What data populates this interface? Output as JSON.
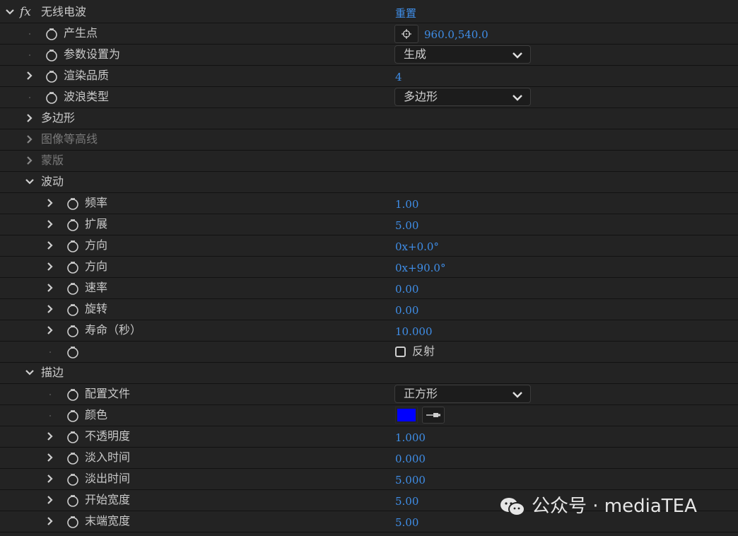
{
  "effect": {
    "name": "无线电波",
    "reset_label": "重置"
  },
  "rows": {
    "origin": {
      "label": "产生点",
      "value": "960.0,540.0"
    },
    "param_set": {
      "label": "参数设置为",
      "value": "生成"
    },
    "render_quality": {
      "label": "渲染品质",
      "value": "4"
    },
    "wave_type": {
      "label": "波浪类型",
      "value": "多边形"
    },
    "polygon": {
      "label": "多边形"
    },
    "image_contour": {
      "label": "图像等高线"
    },
    "mask": {
      "label": "蒙版"
    },
    "wave_motion": {
      "label": "波动"
    },
    "frequency": {
      "label": "频率",
      "value": "1.00"
    },
    "expansion": {
      "label": "扩展",
      "value": "5.00"
    },
    "orientation": {
      "label": "方向",
      "value": "0x+0.0°"
    },
    "direction": {
      "label": "方向",
      "value": "0x+90.0°"
    },
    "velocity": {
      "label": "速率",
      "value": "0.00"
    },
    "spin": {
      "label": "旋转",
      "value": "0.00"
    },
    "lifespan": {
      "label": "寿命（秒）",
      "value": "10.000"
    },
    "reflection": {
      "label": "反射"
    },
    "stroke": {
      "label": "描边"
    },
    "profile": {
      "label": "配置文件",
      "value": "正方形"
    },
    "color": {
      "label": "颜色",
      "swatch": "#0000ff"
    },
    "opacity": {
      "label": "不透明度",
      "value": "1.000"
    },
    "fade_in": {
      "label": "淡入时间",
      "value": "0.000"
    },
    "fade_out": {
      "label": "淡出时间",
      "value": "5.000"
    },
    "start_width": {
      "label": "开始宽度",
      "value": "5.00"
    },
    "end_width": {
      "label": "末端宽度",
      "value": "5.00"
    }
  },
  "watermark": {
    "text": "公众号 · mediaTEA"
  },
  "colors": {
    "background": "#232323",
    "value_blue": "#3f8ee8",
    "label": "#c9c9c9",
    "disabled": "#7a7a7a"
  }
}
